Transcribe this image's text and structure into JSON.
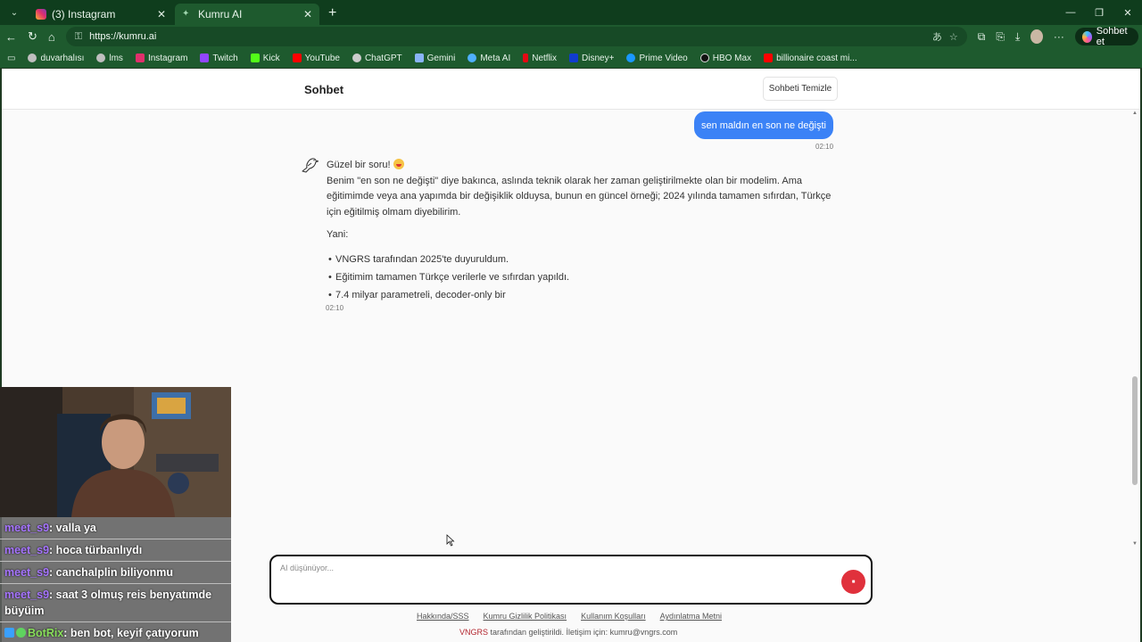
{
  "browser": {
    "tabs": [
      {
        "title": "(3) Instagram",
        "active": false,
        "icon": "instagram-icon"
      },
      {
        "title": "Kumru AI",
        "active": true,
        "icon": "kumru-bird-icon"
      }
    ],
    "url": "https://kumru.ai",
    "sohbet_button": "Sohbet et",
    "bookmarks": [
      {
        "label": "duvarhalısı",
        "icon": "globe-icon",
        "color": "#bfbfbf"
      },
      {
        "label": "lms",
        "icon": "globe-icon",
        "color": "#bfbfbf"
      },
      {
        "label": "Instagram",
        "icon": "instagram-icon",
        "color": "#e1306c"
      },
      {
        "label": "Twitch",
        "icon": "twitch-icon",
        "color": "#9146ff"
      },
      {
        "label": "Kick",
        "icon": "kick-icon",
        "color": "#53fc18"
      },
      {
        "label": "YouTube",
        "icon": "youtube-icon",
        "color": "#ff0000"
      },
      {
        "label": "ChatGPT",
        "icon": "chatgpt-icon",
        "color": "#cccccc"
      },
      {
        "label": "Gemini",
        "icon": "gemini-icon",
        "color": "#8ab4f8"
      },
      {
        "label": "Meta AI",
        "icon": "meta-ai-icon",
        "color": "#4fb0ff"
      },
      {
        "label": "Netflix",
        "icon": "netflix-icon",
        "color": "#e50914"
      },
      {
        "label": "Disney+",
        "icon": "disney-icon",
        "color": "#113ccf"
      },
      {
        "label": "Prime Video",
        "icon": "prime-video-icon",
        "color": "#1a98ff"
      },
      {
        "label": "HBO Max",
        "icon": "hbo-max-icon",
        "color": "#111111"
      },
      {
        "label": "billionaire coast mi...",
        "icon": "youtube-icon",
        "color": "#ff0000"
      }
    ]
  },
  "app": {
    "header_title": "Sohbet",
    "clear_button": "Sohbeti Temizle",
    "user_message": "sen maldın en son ne değişti",
    "user_time": "02:10",
    "ai_intro": "Güzel bir soru!",
    "ai_para": "Benim \"en son ne değişti\" diye bakınca, aslında teknik olarak her zaman geliştirilmekte olan bir modelim. Ama eğitimimde veya ana yapımda bir değişiklik olduysa, bunun en güncel örneği; 2024 yılında tamamen sıfırdan, Türkçe için eğitilmiş olmam diyebilirim.",
    "ai_yani": "Yani:",
    "ai_bullets": [
      "VNGRS tarafından 2025'te duyuruldum.",
      "Eğitimim tamamen Türkçe verilerle ve sıfırdan yapıldı.",
      "7.4 milyar parametreli, decoder-only bir"
    ],
    "ai_time": "02:10",
    "input_placeholder": "AI düşünüyor...",
    "footer_links": [
      "Hakkında/SSS",
      "Kumru Gizlilik Politikası",
      "Kullanım Koşulları",
      "Aydınlatma Metni"
    ],
    "footer_brand": "VNGRS",
    "footer_note": " tarafından geliştirildi. İletişim için: kumru@vngrs.com"
  },
  "stream_chat": [
    {
      "user": "meet_s9",
      "message": ": valla ya"
    },
    {
      "user": "meet_s9",
      "message": ": hoca türbanlıydı"
    },
    {
      "user": "meet_s9",
      "message": ": canchalplin biliyonmu"
    },
    {
      "user": "meet_s9",
      "message": ": saat 3 olmuş reis benyatımde büyüim"
    },
    {
      "user": "BotRix",
      "message": ": ben bot, keyif çatıyorum"
    }
  ]
}
